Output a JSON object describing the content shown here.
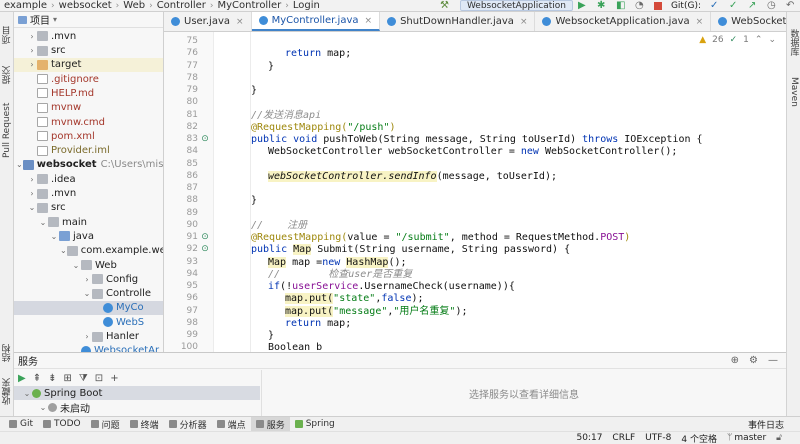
{
  "topbar": {
    "breadcrumbs": [
      "example",
      "websocket",
      "Web",
      "Controller",
      "MyController",
      "Login"
    ],
    "run_config": "WebsocketApplication",
    "git_label": "Git(G):"
  },
  "left_strip": {
    "tabs": [
      "项目",
      "提交",
      "Pull Request",
      "结构",
      "收藏夹"
    ]
  },
  "right_strip": {
    "tabs": [
      "数据库",
      "Maven"
    ]
  },
  "project_panel": {
    "title": "项目",
    "rows": [
      {
        "arrow": "›",
        "icon": "folder",
        "label": ".mvn",
        "indent": 1
      },
      {
        "arrow": "›",
        "icon": "folder",
        "label": "src",
        "indent": 1
      },
      {
        "arrow": "›",
        "icon": "folder-orange",
        "label": "target",
        "indent": 1,
        "hl": true
      },
      {
        "arrow": "",
        "icon": "file",
        "label": ".gitignore",
        "indent": 1,
        "color": "red"
      },
      {
        "arrow": "",
        "icon": "file",
        "label": "HELP.md",
        "indent": 1,
        "color": "red"
      },
      {
        "arrow": "",
        "icon": "file",
        "label": "mvnw",
        "indent": 1,
        "color": "red"
      },
      {
        "arrow": "",
        "icon": "file",
        "label": "mvnw.cmd",
        "indent": 1,
        "color": "red"
      },
      {
        "arrow": "",
        "icon": "file",
        "label": "pom.xml",
        "indent": 1,
        "color": "red"
      },
      {
        "arrow": "",
        "icon": "file",
        "label": "Provider.iml",
        "indent": 1,
        "color": "olive"
      },
      {
        "arrow": "⌄",
        "icon": "module",
        "label": "websocket",
        "indent": 0,
        "bold": true,
        "muted": "C:\\Users\\misak\\Id"
      },
      {
        "arrow": "›",
        "icon": "folder",
        "label": ".idea",
        "indent": 1
      },
      {
        "arrow": "›",
        "icon": "folder",
        "label": ".mvn",
        "indent": 1
      },
      {
        "arrow": "⌄",
        "icon": "folder",
        "label": "src",
        "indent": 1
      },
      {
        "arrow": "⌄",
        "icon": "folder",
        "label": "main",
        "indent": 2
      },
      {
        "arrow": "⌄",
        "icon": "folder-blue",
        "label": "java",
        "indent": 3
      },
      {
        "arrow": "⌄",
        "icon": "folder",
        "label": "com.example.wel",
        "indent": 4
      },
      {
        "arrow": "⌄",
        "icon": "folder",
        "label": "Web",
        "indent": 5
      },
      {
        "arrow": "›",
        "icon": "folder",
        "label": "Config",
        "indent": 6
      },
      {
        "arrow": "⌄",
        "icon": "folder",
        "label": "Controlle",
        "indent": 6
      },
      {
        "arrow": "",
        "icon": "class",
        "label": "MyCo",
        "indent": 7,
        "sel": true
      },
      {
        "arrow": "",
        "icon": "class",
        "label": "WebS",
        "indent": 7
      },
      {
        "arrow": "›",
        "icon": "folder",
        "label": "Hanler",
        "indent": 6
      },
      {
        "arrow": "",
        "icon": "class",
        "label": "WebsocketAr",
        "indent": 5
      }
    ]
  },
  "tabs": [
    {
      "label": "User.java",
      "active": false
    },
    {
      "label": "MyController.java",
      "active": true
    },
    {
      "label": "ShutDownHandler.java",
      "active": false
    },
    {
      "label": "WebsocketApplication.java",
      "active": false
    },
    {
      "label": "WebSocketController.java",
      "active": false
    },
    {
      "label": "WebSo",
      "active": false
    }
  ],
  "editor": {
    "hint_count": "26",
    "warn_count": "1",
    "line_numbers": [
      "75",
      "76",
      "77",
      "78",
      "79",
      "80",
      "81",
      "82",
      "83",
      "84",
      "85",
      "86",
      "87",
      "88",
      "89",
      "90",
      "91",
      "92",
      "93",
      "94",
      "95",
      "96",
      "97",
      "98",
      "99",
      "100"
    ],
    "lines": [
      {
        "indent": 2,
        "html_parts": [
          {
            "t": "",
            "c": ""
          }
        ]
      },
      {
        "indent": 3,
        "html_parts": [
          {
            "t": "return",
            "c": "kw"
          },
          {
            "t": " map;",
            "c": ""
          }
        ]
      },
      {
        "indent": 2,
        "html_parts": [
          {
            "t": "}",
            "c": ""
          }
        ]
      },
      {
        "indent": 0,
        "html_parts": [
          {
            "t": "",
            "c": ""
          }
        ]
      },
      {
        "indent": 1,
        "html_parts": [
          {
            "t": "}",
            "c": ""
          }
        ]
      },
      {
        "indent": 0,
        "html_parts": [
          {
            "t": "",
            "c": ""
          }
        ]
      },
      {
        "indent": 1,
        "html_parts": [
          {
            "t": "//发送消息api",
            "c": "cmt"
          }
        ]
      },
      {
        "indent": 1,
        "html_parts": [
          {
            "t": "@RequestMapping(",
            "c": "ann"
          },
          {
            "t": "\"/push\"",
            "c": "str"
          },
          {
            "t": ")",
            "c": "ann"
          }
        ]
      },
      {
        "indent": 1,
        "html_parts": [
          {
            "t": "public void",
            "c": "kw"
          },
          {
            "t": " pushToWeb(String message, String toUserId) ",
            "c": ""
          },
          {
            "t": "throws",
            "c": "kw"
          },
          {
            "t": " IOException {",
            "c": ""
          }
        ]
      },
      {
        "indent": 2,
        "html_parts": [
          {
            "t": "WebSocketController webSocketController = ",
            "c": ""
          },
          {
            "t": "new",
            "c": "kw"
          },
          {
            "t": " WebSocketController();",
            "c": ""
          }
        ]
      },
      {
        "indent": 0,
        "html_parts": [
          {
            "t": "",
            "c": ""
          }
        ]
      },
      {
        "indent": 2,
        "html_parts": [
          {
            "t": "webSocketController.sendInfo",
            "c": "hlbg"
          },
          {
            "t": "(message, toUserId);",
            "c": ""
          }
        ]
      },
      {
        "indent": 0,
        "html_parts": [
          {
            "t": "",
            "c": ""
          }
        ]
      },
      {
        "indent": 1,
        "html_parts": [
          {
            "t": "}",
            "c": ""
          }
        ]
      },
      {
        "indent": 0,
        "html_parts": [
          {
            "t": "",
            "c": ""
          }
        ]
      },
      {
        "indent": 1,
        "html_parts": [
          {
            "t": "//    注册",
            "c": "cmt"
          }
        ]
      },
      {
        "indent": 1,
        "html_parts": [
          {
            "t": "@RequestMapping(",
            "c": "ann"
          },
          {
            "t": "value = ",
            "c": ""
          },
          {
            "t": "\"/submit\"",
            "c": "str"
          },
          {
            "t": ", method = RequestMethod.",
            "c": ""
          },
          {
            "t": "POST",
            "c": "fld"
          },
          {
            "t": ")",
            "c": "ann"
          }
        ]
      },
      {
        "indent": 1,
        "html_parts": [
          {
            "t": "public",
            "c": "kw"
          },
          {
            "t": " ",
            "c": ""
          },
          {
            "t": "Map",
            "c": "hlbg"
          },
          {
            "t": " Submit(String username, String password) {",
            "c": ""
          }
        ]
      },
      {
        "indent": 2,
        "html_parts": [
          {
            "t": "Map",
            "c": "hlbg"
          },
          {
            "t": " map =",
            "c": ""
          },
          {
            "t": "new",
            "c": "kw"
          },
          {
            "t": " ",
            "c": ""
          },
          {
            "t": "HashMap",
            "c": "hlbg"
          },
          {
            "t": "();",
            "c": ""
          }
        ]
      },
      {
        "indent": 2,
        "html_parts": [
          {
            "t": "//        检查user是否重复",
            "c": "cmt"
          }
        ]
      },
      {
        "indent": 2,
        "html_parts": [
          {
            "t": "if",
            "c": "kw"
          },
          {
            "t": "(!",
            "c": ""
          },
          {
            "t": "userService",
            "c": "fld"
          },
          {
            "t": ".UsernameCheck(username)){",
            "c": ""
          }
        ]
      },
      {
        "indent": 3,
        "html_parts": [
          {
            "t": "map.put(",
            "c": "hlbg"
          },
          {
            "t": "\"state\"",
            "c": "str"
          },
          {
            "t": ",",
            "c": ""
          },
          {
            "t": "false",
            "c": "kw"
          },
          {
            "t": ");",
            "c": ""
          }
        ]
      },
      {
        "indent": 3,
        "html_parts": [
          {
            "t": "map.put(",
            "c": "hlbg"
          },
          {
            "t": "\"message\"",
            "c": "str"
          },
          {
            "t": ",",
            "c": ""
          },
          {
            "t": "\"用户名重复\"",
            "c": "str"
          },
          {
            "t": ");",
            "c": ""
          }
        ]
      },
      {
        "indent": 3,
        "html_parts": [
          {
            "t": "return",
            "c": "kw"
          },
          {
            "t": " map;",
            "c": ""
          }
        ]
      },
      {
        "indent": 2,
        "html_parts": [
          {
            "t": "}",
            "c": ""
          }
        ]
      },
      {
        "indent": 2,
        "html_parts": [
          {
            "t": "Boolean b",
            "c": ""
          }
        ]
      }
    ]
  },
  "services": {
    "title": "服务",
    "tree": [
      {
        "label": "Spring Boot",
        "sel": true
      },
      {
        "label": "未启动",
        "sel": false
      }
    ],
    "detail_placeholder": "选择服务以查看详细信息"
  },
  "bottom_tabs": [
    {
      "label": "Git",
      "active": false
    },
    {
      "label": "TODO",
      "active": false
    },
    {
      "label": "问题",
      "active": false
    },
    {
      "label": "终端",
      "active": false
    },
    {
      "label": "分析器",
      "active": false
    },
    {
      "label": "端点",
      "active": false
    },
    {
      "label": "服务",
      "active": true
    },
    {
      "label": "Spring",
      "active": false
    }
  ],
  "event_log": "事件日志",
  "status": {
    "position": "50:17",
    "line_sep": "CRLF",
    "encoding": "UTF-8",
    "indent": "4 个空格",
    "branch": "master"
  },
  "colors": {
    "accent": "#4083c9",
    "run_green": "#3ba35a",
    "keyword": "#0033b3",
    "string": "#067d17",
    "annotation": "#9e880d"
  }
}
